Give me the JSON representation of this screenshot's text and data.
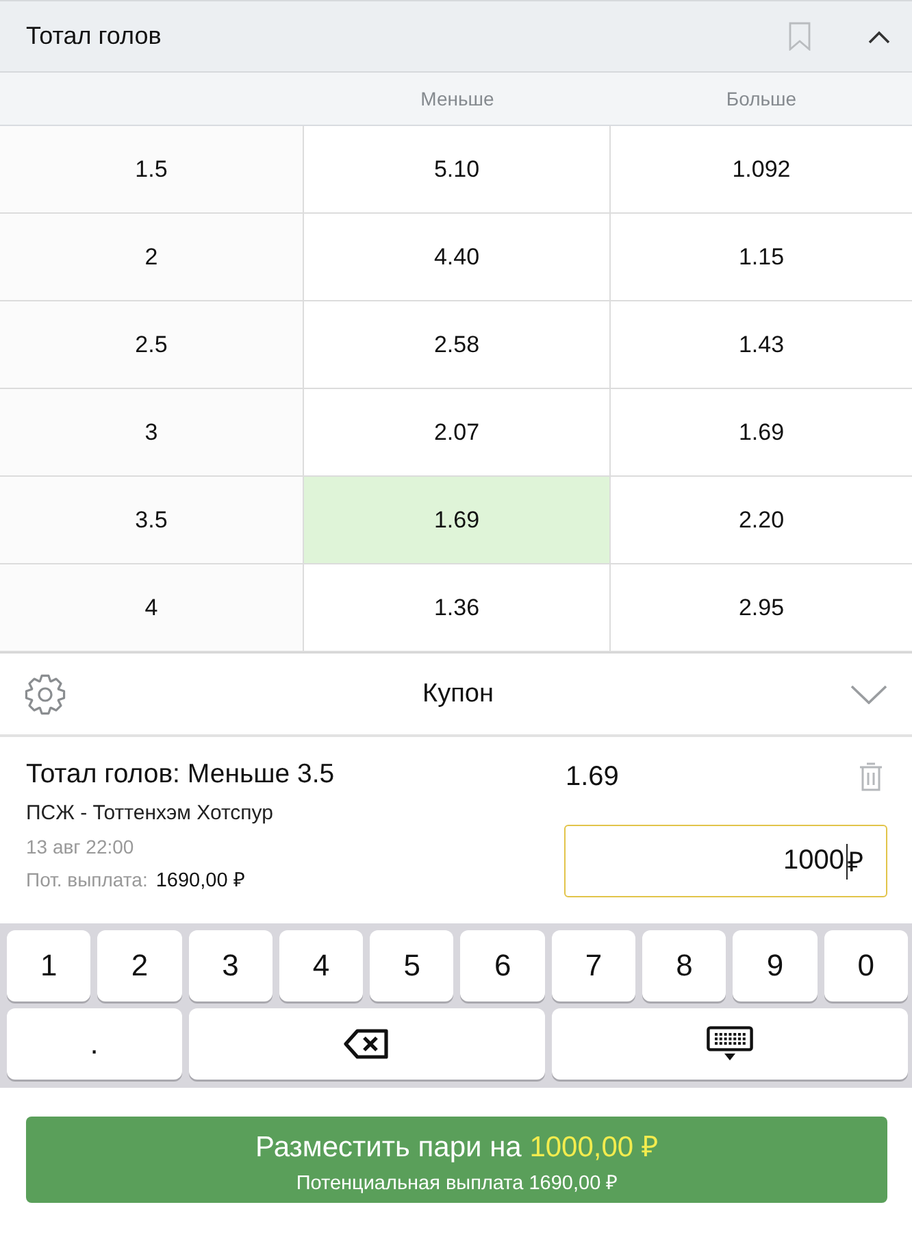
{
  "market": {
    "title": "Тотал голов"
  },
  "table": {
    "columns": [
      "Меньше",
      "Больше"
    ],
    "rows": [
      {
        "line": "1.5",
        "cells": [
          {
            "odds": "5.10",
            "selected": false
          },
          {
            "odds": "1.092",
            "selected": false
          }
        ]
      },
      {
        "line": "2",
        "cells": [
          {
            "odds": "4.40",
            "selected": false
          },
          {
            "odds": "1.15",
            "selected": false
          }
        ]
      },
      {
        "line": "2.5",
        "cells": [
          {
            "odds": "2.58",
            "selected": false
          },
          {
            "odds": "1.43",
            "selected": false
          }
        ]
      },
      {
        "line": "3",
        "cells": [
          {
            "odds": "2.07",
            "selected": false
          },
          {
            "odds": "1.69",
            "selected": false
          }
        ]
      },
      {
        "line": "3.5",
        "cells": [
          {
            "odds": "1.69",
            "selected": true
          },
          {
            "odds": "2.20",
            "selected": false
          }
        ]
      },
      {
        "line": "4",
        "cells": [
          {
            "odds": "1.36",
            "selected": false
          },
          {
            "odds": "2.95",
            "selected": false
          }
        ]
      }
    ]
  },
  "coupon": {
    "title": "Купон"
  },
  "bet": {
    "title": "Тотал голов: Меньше 3.5",
    "match": "ПСЖ - Тоттенхэм Хотспур",
    "time": "13 авг 22:00",
    "payout_label": "Пот. выплата:",
    "payout_value": "1690,00 ₽",
    "odds": "1.69",
    "stake": "1000",
    "currency": "₽"
  },
  "keyboard": {
    "rows": [
      [
        {
          "kind": "char",
          "label": "1"
        },
        {
          "kind": "char",
          "label": "2"
        },
        {
          "kind": "char",
          "label": "3"
        },
        {
          "kind": "char",
          "label": "4"
        },
        {
          "kind": "char",
          "label": "5"
        },
        {
          "kind": "char",
          "label": "6"
        },
        {
          "kind": "char",
          "label": "7"
        },
        {
          "kind": "char",
          "label": "8"
        },
        {
          "kind": "char",
          "label": "9"
        },
        {
          "kind": "char",
          "label": "0"
        }
      ],
      [
        {
          "kind": "char",
          "label": "."
        },
        {
          "kind": "backspace"
        },
        {
          "kind": "hide"
        }
      ]
    ]
  },
  "place_button": {
    "label": "Разместить пари на",
    "amount": "1000,00 ₽",
    "subtitle": "Потенциальная выплата 1690,00 ₽"
  }
}
